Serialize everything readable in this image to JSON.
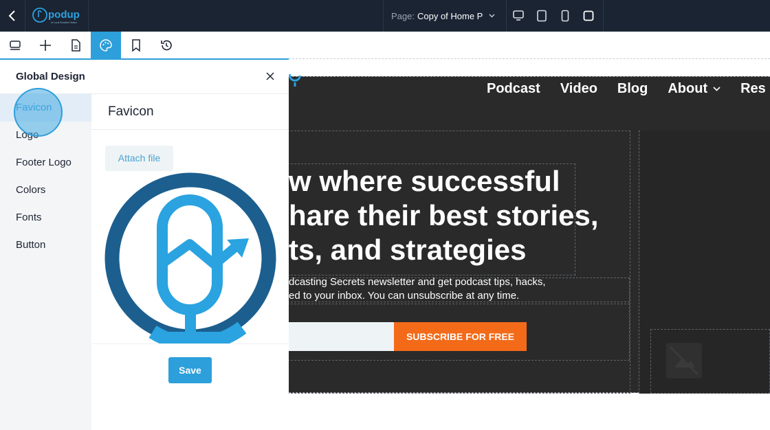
{
  "app": {
    "logo_text": "podup",
    "logo_tagline": "for Local Showtime Station"
  },
  "topbar": {
    "page_label": "Page:",
    "page_value": "Copy of Home P",
    "devices": [
      "desktop-icon",
      "tablet-icon",
      "mobile-icon",
      "fullscreen-icon"
    ]
  },
  "toolbar": {
    "tools": [
      "layers-icon",
      "add-icon",
      "page-icon",
      "palette-icon",
      "bookmark-icon",
      "history-icon"
    ],
    "active_tool": "palette-icon"
  },
  "panel": {
    "title": "Global Design",
    "menu": [
      "Favicon",
      "Logo",
      "Footer Logo",
      "Colors",
      "Fonts",
      "Button"
    ],
    "active_item": "Favicon",
    "content_title": "Favicon",
    "attach_label": "Attach file",
    "save_label": "Save"
  },
  "preview": {
    "nav": [
      "Podcast",
      "Video",
      "Blog",
      "About",
      "Res"
    ],
    "headline": [
      "w where successful",
      "hare their best stories,",
      "ts, and strategies"
    ],
    "subtext": [
      "dcasting Secrets newsletter and get podcast tips, hacks,",
      "ed to your inbox. You can unsubscribe at any time."
    ],
    "subscribe_label": "SUBSCRIBE FOR FREE"
  },
  "colors": {
    "topbar": "#1b2433",
    "accent": "#2d9fdb",
    "favicon_dark": "#1c5f8f",
    "favicon_light": "#2aa3e0",
    "cta": "#f36a19",
    "site_bg": "#2a2a2a"
  }
}
